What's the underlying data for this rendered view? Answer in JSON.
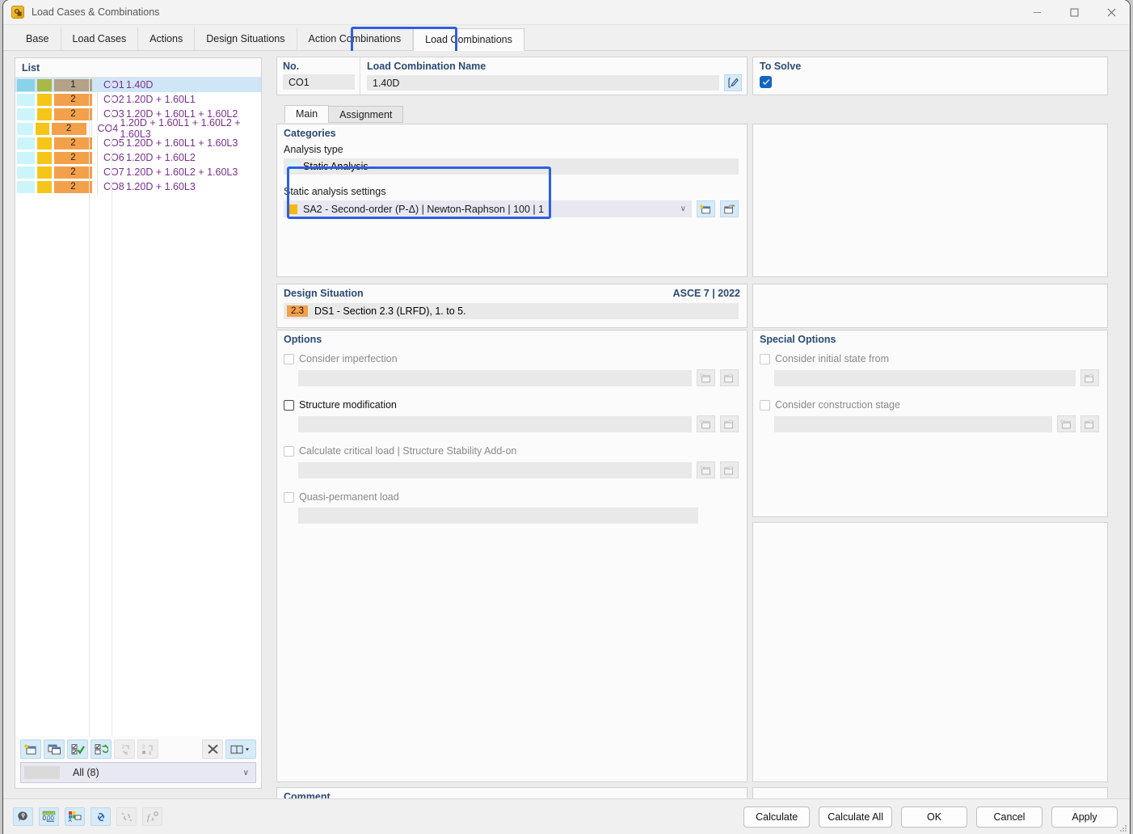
{
  "window": {
    "title": "Load Cases & Combinations",
    "icon": "app-icon",
    "minimize": "—",
    "maximize": "□",
    "close": "✕"
  },
  "tabs": [
    {
      "label": "Base",
      "active": false
    },
    {
      "label": "Load Cases",
      "active": false
    },
    {
      "label": "Actions",
      "active": false
    },
    {
      "label": "Design Situations",
      "active": false
    },
    {
      "label": "Action Combinations",
      "active": false
    },
    {
      "label": "Load Combinations",
      "active": true
    }
  ],
  "list": {
    "header": "List",
    "rows": [
      {
        "no": "CO1",
        "name": "1.40D",
        "badge": "1",
        "chip_a": "#89d3ea",
        "chip_b": "#a8b94a",
        "chip_c": "#b5a088",
        "selected": true
      },
      {
        "no": "CO2",
        "name": "1.20D + 1.60L1",
        "badge": "2",
        "chip_a": "#ccf5fb",
        "chip_b": "#f5c518",
        "chip_c": "#f3a04a",
        "selected": false
      },
      {
        "no": "CO3",
        "name": "1.20D + 1.60L1 + 1.60L2",
        "badge": "2",
        "chip_a": "#ccf5fb",
        "chip_b": "#f5c518",
        "chip_c": "#f3a04a",
        "selected": false
      },
      {
        "no": "CO4",
        "name": "1.20D + 1.60L1 + 1.60L2 + 1.60L3",
        "badge": "2",
        "chip_a": "#ccf5fb",
        "chip_b": "#f5c518",
        "chip_c": "#f3a04a",
        "selected": false
      },
      {
        "no": "CO5",
        "name": "1.20D + 1.60L1 + 1.60L3",
        "badge": "2",
        "chip_a": "#ccf5fb",
        "chip_b": "#f5c518",
        "chip_c": "#f3a04a",
        "selected": false
      },
      {
        "no": "CO6",
        "name": "1.20D + 1.60L2",
        "badge": "2",
        "chip_a": "#ccf5fb",
        "chip_b": "#f5c518",
        "chip_c": "#f3a04a",
        "selected": false
      },
      {
        "no": "CO7",
        "name": "1.20D + 1.60L2 + 1.60L3",
        "badge": "2",
        "chip_a": "#ccf5fb",
        "chip_b": "#f5c518",
        "chip_c": "#f3a04a",
        "selected": false
      },
      {
        "no": "CO8",
        "name": "1.20D + 1.60L3",
        "badge": "2",
        "chip_a": "#ccf5fb",
        "chip_b": "#f5c518",
        "chip_c": "#f3a04a",
        "selected": false
      }
    ],
    "toolbar": [
      {
        "name": "new-item-button",
        "icon": "new-window-star-icon",
        "enabled": true
      },
      {
        "name": "copy-item-button",
        "icon": "copy-window-icon",
        "enabled": true
      },
      {
        "name": "select-all-button",
        "icon": "checkbox-check-icon",
        "enabled": true
      },
      {
        "name": "invert-selection-button",
        "icon": "checkbox-swap-icon",
        "enabled": true
      },
      {
        "name": "renumber-button",
        "icon": "renumber-icon",
        "enabled": false
      },
      {
        "name": "sort-button",
        "icon": "sort-numbers-icon",
        "enabled": false
      },
      {
        "name": "delete-button",
        "icon": "close-x-icon",
        "enabled": true
      },
      {
        "name": "view-mode-button",
        "icon": "columns-icon",
        "enabled": true
      }
    ],
    "filter": "All (8)",
    "filter_caret": "∨"
  },
  "no_field": {
    "label": "No.",
    "value": "CO1"
  },
  "name_field": {
    "label": "Load Combination Name",
    "value": "1.40D",
    "edit_icon": "edit-pencil-icon"
  },
  "to_solve": {
    "label": "To Solve",
    "checked": true,
    "check_glyph": "✓"
  },
  "inner_tabs": [
    {
      "label": "Main",
      "active": true
    },
    {
      "label": "Assignment",
      "active": false
    }
  ],
  "categories": {
    "title": "Categories",
    "analysis_type_label": "Analysis type",
    "analysis_type_value": "Static Analysis",
    "analysis_type_swatch": "#d6f5fb",
    "settings_label": "Static analysis settings",
    "settings_value": "SA2 - Second-order (P-Δ) | Newton-Raphson | 100 | 1",
    "settings_swatch": "#f5b90f",
    "settings_caret": "∨",
    "new_button_icon": "new-window-star-icon",
    "edit_button_icon": "edit-window-icon"
  },
  "design_situation": {
    "title": "Design Situation",
    "standard": "ASCE 7 | 2022",
    "badge": "2.3",
    "badge_color": "#f3a04a",
    "value": "DS1 - Section 2.3 (LRFD), 1. to 5."
  },
  "options": {
    "title": "Options",
    "items": [
      {
        "label": "Consider imperfection",
        "checked": false,
        "enabled": false,
        "has_field": true,
        "buttons": 2
      },
      {
        "label": "Structure modification",
        "checked": false,
        "enabled": true,
        "has_field": true,
        "buttons": 2
      },
      {
        "label": "Calculate critical load | Structure Stability Add-on",
        "checked": false,
        "enabled": false,
        "has_field": true,
        "buttons": 2
      },
      {
        "label": "Quasi-permanent load",
        "checked": false,
        "enabled": false,
        "has_field": true,
        "buttons": 0
      }
    ]
  },
  "special_options": {
    "title": "Special Options",
    "items": [
      {
        "label": "Consider initial state from",
        "checked": false,
        "enabled": false,
        "buttons": 1
      },
      {
        "label": "Consider construction stage",
        "checked": false,
        "enabled": false,
        "buttons": 2
      }
    ]
  },
  "comment": {
    "title": "Comment",
    "value": "",
    "caret": "∨",
    "copy_icon": "copy-pages-icon"
  },
  "bottom_icons": [
    {
      "name": "info-bubble-icon",
      "enabled": true
    },
    {
      "name": "decimal-places-icon",
      "enabled": true
    },
    {
      "name": "colors-legend-icon",
      "enabled": true
    },
    {
      "name": "link-icon",
      "enabled": true
    },
    {
      "name": "unlink-icon",
      "enabled": false
    },
    {
      "name": "formula-icon",
      "enabled": false
    }
  ],
  "dialog_buttons": [
    {
      "label": "Calculate",
      "name": "calculate-button"
    },
    {
      "label": "Calculate All",
      "name": "calculate-all-button"
    },
    {
      "label": "OK",
      "name": "ok-button"
    },
    {
      "label": "Cancel",
      "name": "cancel-button"
    },
    {
      "label": "Apply",
      "name": "apply-button"
    }
  ],
  "colors": {
    "accent_blue": "#2f5fe0",
    "header_blue": "#2b4a73",
    "selection": "#cfe6f7",
    "row_text": "#7a2f8f"
  }
}
